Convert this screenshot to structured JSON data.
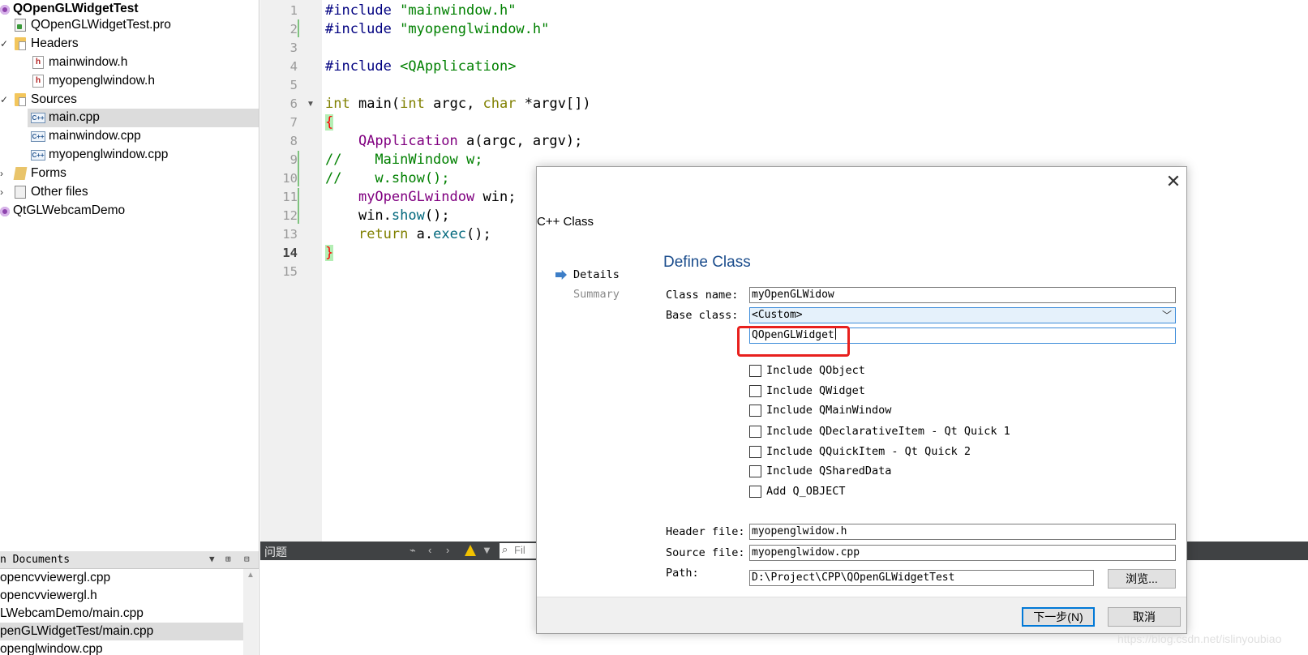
{
  "project_tree": {
    "project_name": "QOpenGLWidgetTest",
    "pro_file": "QOpenGLWidgetTest.pro",
    "headers_label": "Headers",
    "header_files": [
      "mainwindow.h",
      "myopenglwindow.h"
    ],
    "sources_label": "Sources",
    "source_files": [
      "main.cpp",
      "mainwindow.cpp",
      "myopenglwindow.cpp"
    ],
    "forms_label": "Forms",
    "other_files_label": "Other files",
    "second_project": "QtGLWebcamDemo"
  },
  "open_documents": {
    "title": "n Documents",
    "items": [
      "opencvviewergl.cpp",
      "opencvviewergl.h",
      "LWebcamDemo/main.cpp",
      "penGLWidgetTest/main.cpp",
      "openglwindow.cpp"
    ]
  },
  "editor": {
    "line_numbers": [
      "1",
      "2",
      "3",
      "4",
      "5",
      "6",
      "7",
      "8",
      "9",
      "10",
      "11",
      "12",
      "13",
      "14",
      "15"
    ],
    "current_line": "14",
    "code": {
      "l1_directive": "#include",
      "l1_file": "\"mainwindow.h\"",
      "l2_directive": "#include",
      "l2_file": "\"myopenglwindow.h\"",
      "l4_directive": "#include",
      "l4_file": "<QApplication>",
      "l6_int": "int",
      "l6_main": "main(",
      "l6_int2": "int",
      "l6_argc": "argc, ",
      "l6_char": "char",
      "l6_argv": "*argv[])",
      "l7_open": "{",
      "l8_type": "QApplication",
      "l8_rest": " a(argc, argv);",
      "l9_comment": "//    MainWindow w;",
      "l10_comment": "//    w.show();",
      "l11_type": "myOpenGLwindow",
      "l11_rest": " win;",
      "l12_obj": "win.",
      "l12_fn": "show",
      "l12_rest": "();",
      "l13_ret": "return",
      "l13_obj": " a.",
      "l13_fn": "exec",
      "l13_rest": "();",
      "l14_close": "}"
    }
  },
  "issues": {
    "title": "问题",
    "filter_placeholder": "Fil"
  },
  "dialog": {
    "window_title": "C++ Class",
    "wizard_steps": {
      "details": "Details",
      "summary": "Summary"
    },
    "page_title": "Define Class",
    "class_name_label": "Class name:",
    "class_name_value": "myOpenGLWidow",
    "base_class_label": "Base class:",
    "base_class_value": "<Custom>",
    "custom_base_value": "QOpenGLWidget",
    "checkboxes": [
      "Include QObject",
      "Include QWidget",
      "Include QMainWindow",
      "Include QDeclarativeItem - Qt Quick 1",
      "Include QQuickItem - Qt Quick 2",
      "Include QSharedData",
      "Add Q_OBJECT"
    ],
    "header_file_label": "Header file:",
    "header_file_value": "myopenglwidow.h",
    "source_file_label": "Source file:",
    "source_file_value": "myopenglwidow.cpp",
    "path_label": "Path:",
    "path_value": "D:\\Project\\CPP\\QOpenGLWidgetTest",
    "browse_label": "浏览...",
    "next_label": "下一步(N)",
    "cancel_label": "取消"
  },
  "watermark": "https://blog.csdn.net/islinyoubiao",
  "colors": {
    "accent_blue": "#1a4c8c",
    "highlight_red": "#e8201d",
    "issues_bar": "#404244"
  }
}
